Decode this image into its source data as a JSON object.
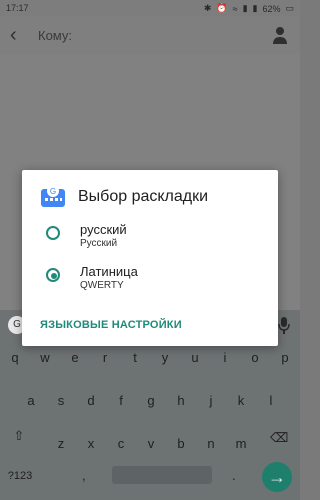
{
  "status": {
    "time": "17:17",
    "battery": "62%"
  },
  "appbar": {
    "to_placeholder": "Кому:"
  },
  "dialog": {
    "title": "Выбор раскладки",
    "options": [
      {
        "name": "русский",
        "sub": "Русский",
        "selected": false
      },
      {
        "name": "Латиница",
        "sub": "QWERTY",
        "selected": true
      }
    ],
    "link": "ЯЗЫКОВЫЕ НАСТРОЙКИ"
  },
  "keyboard": {
    "row1": [
      "q",
      "w",
      "e",
      "r",
      "t",
      "y",
      "u",
      "i",
      "o",
      "p"
    ],
    "row2": [
      "a",
      "s",
      "d",
      "f",
      "g",
      "h",
      "j",
      "k",
      "l"
    ],
    "row3": [
      "z",
      "x",
      "c",
      "v",
      "b",
      "n",
      "m"
    ],
    "sym": "?123",
    "comma": ",",
    "dot": "."
  },
  "colors": {
    "accent": "#1f8a78",
    "enter": "#1f7f6d"
  }
}
